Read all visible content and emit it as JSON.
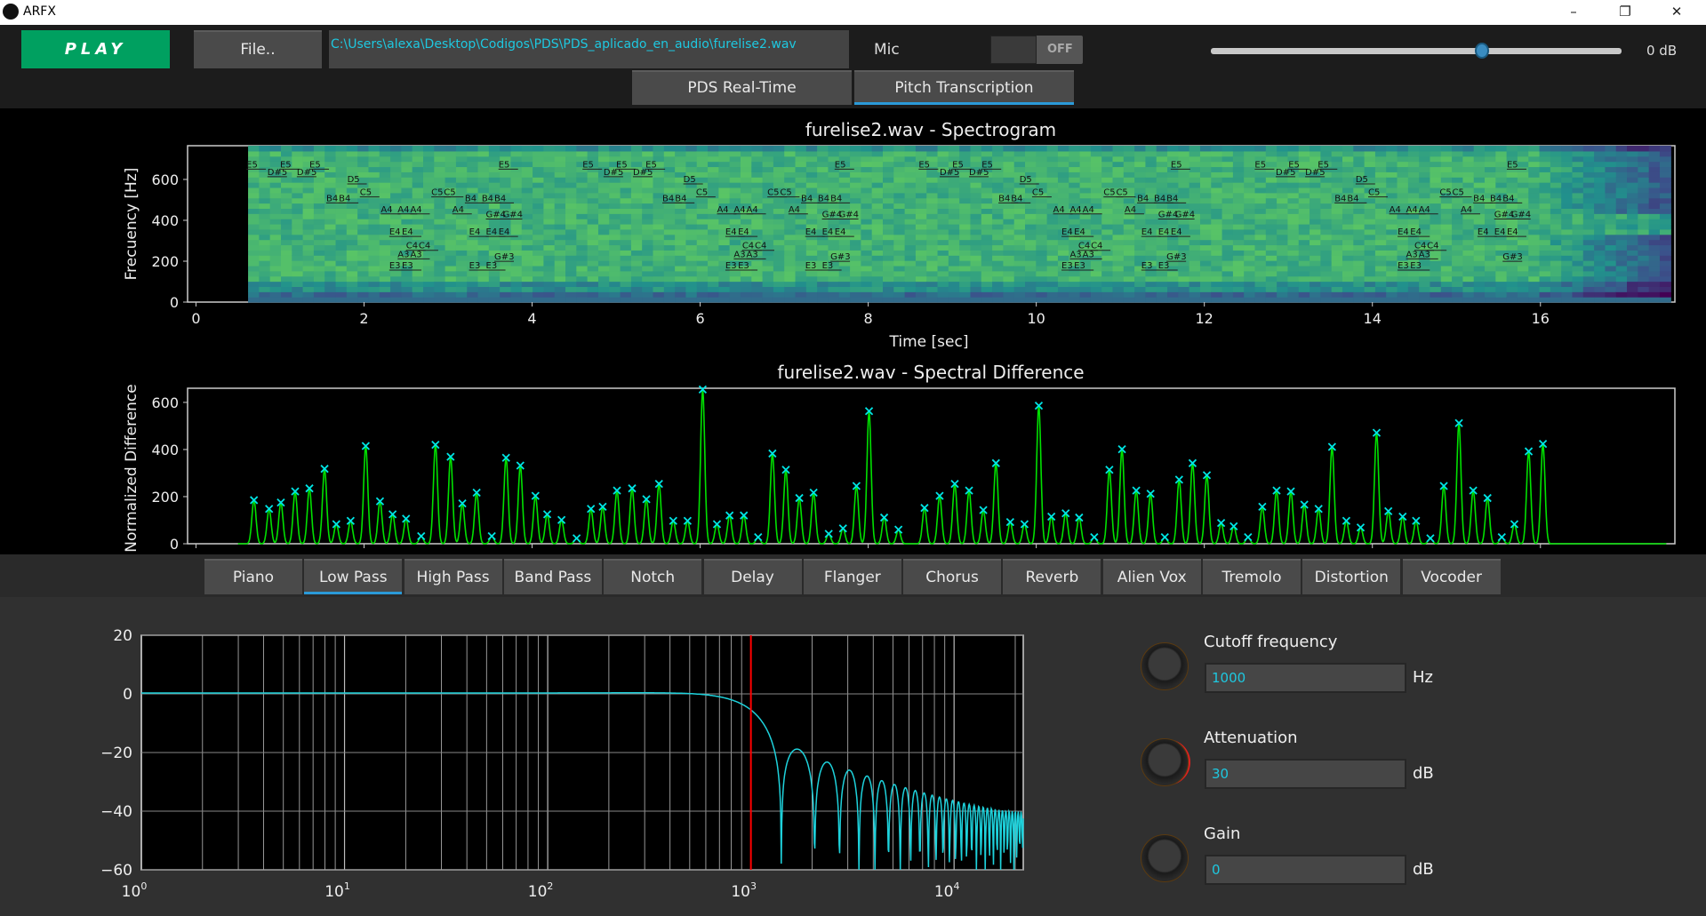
{
  "window": {
    "title": "ARFX",
    "min": "–",
    "max": "❐",
    "close": "✕"
  },
  "toolbar": {
    "play": "PLAY",
    "file": "File..",
    "path": "C:\\Users\\alexa\\Desktop\\Codigos\\PDS\\PDS_aplicado_en_audio\\furelise2.wav",
    "mic": "Mic",
    "mic_state": "OFF",
    "volume_label": "0 dB",
    "volume_fraction": 0.66
  },
  "tabs": [
    {
      "label": "PDS Real-Time"
    },
    {
      "label": "Pitch Transcription",
      "selected": true
    }
  ],
  "effects": [
    "Piano",
    "Low Pass",
    "High Pass",
    "Band Pass",
    "Notch",
    "Delay",
    "Flanger",
    "Chorus",
    "Reverb",
    "Alien Vox",
    "Tremolo",
    "Distortion",
    "Vocoder"
  ],
  "selected_effect": "Low Pass",
  "params": [
    {
      "label": "Cutoff frequency",
      "value": "1000",
      "unit": "Hz"
    },
    {
      "label": "Attenuation",
      "value": "30",
      "unit": "dB"
    },
    {
      "label": "Gain",
      "value": "0",
      "unit": "dB"
    }
  ],
  "colors": {
    "accent": "#2b9ad8",
    "play": "#00a060",
    "value_text": "#1ec8e0",
    "peaks": "#00e000",
    "markers": "#00e5e5",
    "response": "#1ed2dc",
    "cutoff_line": "#ff0000"
  },
  "chart_data": [
    {
      "type": "heatmap",
      "title": "furelise2.wav - Spectrogram",
      "xlabel": "Time [sec]",
      "ylabel": "Frecuency [Hz]",
      "xlim": [
        -0.1,
        17.6
      ],
      "ylim": [
        0,
        765
      ],
      "xticks": [
        "0",
        "2",
        "4",
        "6",
        "8",
        "10",
        "12",
        "14",
        "16"
      ],
      "yticks": [
        "0",
        "200",
        "400",
        "600"
      ],
      "colormap": "viridis",
      "data_start": 0.62,
      "data_end": 17.55,
      "notes": [
        [
          0.6,
          "E5"
        ],
        [
          0.85,
          "D#5"
        ],
        [
          1.0,
          "E5"
        ],
        [
          1.2,
          "D#5"
        ],
        [
          1.35,
          "E5"
        ],
        [
          1.55,
          "B4"
        ],
        [
          1.7,
          "B4"
        ],
        [
          1.8,
          "D5"
        ],
        [
          1.95,
          "C5"
        ],
        [
          2.2,
          "A4"
        ],
        [
          2.4,
          "A4"
        ],
        [
          2.55,
          "A4"
        ],
        [
          2.3,
          "E4"
        ],
        [
          2.45,
          "E4"
        ],
        [
          2.5,
          "C4"
        ],
        [
          2.65,
          "C4"
        ],
        [
          2.4,
          "A3"
        ],
        [
          2.55,
          "A3"
        ],
        [
          2.3,
          "E3"
        ],
        [
          2.45,
          "E3"
        ],
        [
          2.8,
          "C5"
        ],
        [
          2.95,
          "C5"
        ],
        [
          3.05,
          "A4"
        ],
        [
          3.2,
          "B4"
        ],
        [
          3.4,
          "B4"
        ],
        [
          3.55,
          "B4"
        ],
        [
          3.25,
          "E4"
        ],
        [
          3.45,
          "E4"
        ],
        [
          3.6,
          "E4"
        ],
        [
          3.45,
          "G#4"
        ],
        [
          3.65,
          "G#4"
        ],
        [
          3.55,
          "G#3"
        ],
        [
          3.25,
          "E3"
        ],
        [
          3.45,
          "E3"
        ],
        [
          3.6,
          "E5"
        ],
        [
          4.6,
          "E5"
        ],
        [
          4.85,
          "D#5"
        ],
        [
          5.0,
          "E5"
        ],
        [
          5.2,
          "D#5"
        ],
        [
          5.35,
          "E5"
        ],
        [
          5.55,
          "B4"
        ],
        [
          5.7,
          "B4"
        ],
        [
          5.8,
          "D5"
        ],
        [
          5.95,
          "C5"
        ],
        [
          6.2,
          "A4"
        ],
        [
          6.4,
          "A4"
        ],
        [
          6.55,
          "A4"
        ],
        [
          6.3,
          "E4"
        ],
        [
          6.45,
          "E4"
        ],
        [
          6.5,
          "C4"
        ],
        [
          6.65,
          "C4"
        ],
        [
          6.4,
          "A3"
        ],
        [
          6.55,
          "A3"
        ],
        [
          6.3,
          "E3"
        ],
        [
          6.45,
          "E3"
        ],
        [
          6.8,
          "C5"
        ],
        [
          6.95,
          "C5"
        ],
        [
          7.05,
          "A4"
        ],
        [
          7.2,
          "B4"
        ],
        [
          7.4,
          "B4"
        ],
        [
          7.55,
          "B4"
        ],
        [
          7.25,
          "E4"
        ],
        [
          7.45,
          "E4"
        ],
        [
          7.6,
          "E4"
        ],
        [
          7.45,
          "G#4"
        ],
        [
          7.65,
          "G#4"
        ],
        [
          7.55,
          "G#3"
        ],
        [
          7.25,
          "E3"
        ],
        [
          7.45,
          "E3"
        ],
        [
          7.6,
          "E5"
        ],
        [
          8.6,
          "E5"
        ],
        [
          8.85,
          "D#5"
        ],
        [
          9.0,
          "E5"
        ],
        [
          9.2,
          "D#5"
        ],
        [
          9.35,
          "E5"
        ],
        [
          9.55,
          "B4"
        ],
        [
          9.7,
          "B4"
        ],
        [
          9.8,
          "D5"
        ],
        [
          9.95,
          "C5"
        ],
        [
          10.2,
          "A4"
        ],
        [
          10.4,
          "A4"
        ],
        [
          10.55,
          "A4"
        ],
        [
          10.3,
          "E4"
        ],
        [
          10.45,
          "E4"
        ],
        [
          10.5,
          "C4"
        ],
        [
          10.65,
          "C4"
        ],
        [
          10.4,
          "A3"
        ],
        [
          10.55,
          "A3"
        ],
        [
          10.3,
          "E3"
        ],
        [
          10.45,
          "E3"
        ],
        [
          10.8,
          "C5"
        ],
        [
          10.95,
          "C5"
        ],
        [
          11.05,
          "A4"
        ],
        [
          11.2,
          "B4"
        ],
        [
          11.4,
          "B4"
        ],
        [
          11.55,
          "B4"
        ],
        [
          11.25,
          "E4"
        ],
        [
          11.45,
          "E4"
        ],
        [
          11.6,
          "E4"
        ],
        [
          11.45,
          "G#4"
        ],
        [
          11.65,
          "G#4"
        ],
        [
          11.55,
          "G#3"
        ],
        [
          11.25,
          "E3"
        ],
        [
          11.45,
          "E3"
        ],
        [
          11.6,
          "E5"
        ],
        [
          12.6,
          "E5"
        ],
        [
          12.85,
          "D#5"
        ],
        [
          13.0,
          "E5"
        ],
        [
          13.2,
          "D#5"
        ],
        [
          13.35,
          "E5"
        ],
        [
          13.55,
          "B4"
        ],
        [
          13.7,
          "B4"
        ],
        [
          13.8,
          "D5"
        ],
        [
          13.95,
          "C5"
        ],
        [
          14.2,
          "A4"
        ],
        [
          14.4,
          "A4"
        ],
        [
          14.55,
          "A4"
        ],
        [
          14.3,
          "E4"
        ],
        [
          14.45,
          "E4"
        ],
        [
          14.5,
          "C4"
        ],
        [
          14.65,
          "C4"
        ],
        [
          14.4,
          "A3"
        ],
        [
          14.55,
          "A3"
        ],
        [
          14.3,
          "E3"
        ],
        [
          14.45,
          "E3"
        ],
        [
          14.8,
          "C5"
        ],
        [
          14.95,
          "C5"
        ],
        [
          15.05,
          "A4"
        ],
        [
          15.2,
          "B4"
        ],
        [
          15.4,
          "B4"
        ],
        [
          15.55,
          "B4"
        ],
        [
          15.25,
          "E4"
        ],
        [
          15.45,
          "E4"
        ],
        [
          15.6,
          "E4"
        ],
        [
          15.45,
          "G#4"
        ],
        [
          15.65,
          "G#4"
        ],
        [
          15.55,
          "G#3"
        ],
        [
          15.6,
          "E5"
        ]
      ]
    },
    {
      "type": "line",
      "title": "furelise2.wav - Spectral Difference",
      "ylabel": "Normalized Difference",
      "xlim": [
        -0.1,
        17.6
      ],
      "ylim": [
        0,
        660
      ],
      "yticks": [
        "0",
        "200",
        "400",
        "600"
      ],
      "peaks": [
        [
          0.69,
          185
        ],
        [
          0.87,
          148
        ],
        [
          1.01,
          175
        ],
        [
          1.18,
          222
        ],
        [
          1.35,
          235
        ],
        [
          1.53,
          318
        ],
        [
          1.67,
          83
        ],
        [
          1.84,
          97
        ],
        [
          2.02,
          415
        ],
        [
          2.19,
          180
        ],
        [
          2.34,
          125
        ],
        [
          2.5,
          106
        ],
        [
          2.68,
          32
        ],
        [
          2.85,
          420
        ],
        [
          3.03,
          369
        ],
        [
          3.17,
          171
        ],
        [
          3.34,
          217
        ],
        [
          3.52,
          32
        ],
        [
          3.69,
          365
        ],
        [
          3.86,
          332
        ],
        [
          4.04,
          203
        ],
        [
          4.18,
          125
        ],
        [
          4.35,
          101
        ],
        [
          4.53,
          23
        ],
        [
          4.7,
          148
        ],
        [
          4.84,
          157
        ],
        [
          5.01,
          226
        ],
        [
          5.19,
          235
        ],
        [
          5.36,
          189
        ],
        [
          5.51,
          254
        ],
        [
          5.68,
          97
        ],
        [
          5.85,
          97
        ],
        [
          6.03,
          655
        ],
        [
          6.2,
          83
        ],
        [
          6.35,
          120
        ],
        [
          6.52,
          120
        ],
        [
          6.69,
          28
        ],
        [
          6.86,
          383
        ],
        [
          7.02,
          314
        ],
        [
          7.18,
          194
        ],
        [
          7.35,
          217
        ],
        [
          7.53,
          42
        ],
        [
          7.7,
          65
        ],
        [
          7.86,
          245
        ],
        [
          8.01,
          563
        ],
        [
          8.19,
          111
        ],
        [
          8.36,
          60
        ],
        [
          8.67,
          152
        ],
        [
          8.85,
          203
        ],
        [
          9.03,
          254
        ],
        [
          9.2,
          226
        ],
        [
          9.37,
          143
        ],
        [
          9.52,
          342
        ],
        [
          9.69,
          92
        ],
        [
          9.86,
          83
        ],
        [
          10.03,
          586
        ],
        [
          10.18,
          115
        ],
        [
          10.35,
          129
        ],
        [
          10.51,
          111
        ],
        [
          10.69,
          28
        ],
        [
          10.87,
          314
        ],
        [
          11.02,
          401
        ],
        [
          11.19,
          226
        ],
        [
          11.36,
          212
        ],
        [
          11.53,
          28
        ],
        [
          11.7,
          272
        ],
        [
          11.86,
          342
        ],
        [
          12.03,
          291
        ],
        [
          12.2,
          88
        ],
        [
          12.35,
          74
        ],
        [
          12.52,
          28
        ],
        [
          12.69,
          157
        ],
        [
          12.86,
          226
        ],
        [
          13.03,
          222
        ],
        [
          13.19,
          166
        ],
        [
          13.36,
          148
        ],
        [
          13.52,
          411
        ],
        [
          13.69,
          97
        ],
        [
          13.86,
          69
        ],
        [
          14.05,
          471
        ],
        [
          14.19,
          138
        ],
        [
          14.36,
          115
        ],
        [
          14.52,
          97
        ],
        [
          14.69,
          23
        ],
        [
          14.85,
          245
        ],
        [
          15.03,
          512
        ],
        [
          15.2,
          226
        ],
        [
          15.37,
          194
        ],
        [
          15.54,
          28
        ],
        [
          15.69,
          83
        ],
        [
          15.86,
          392
        ],
        [
          16.03,
          424
        ]
      ]
    },
    {
      "type": "line",
      "title": "",
      "xscale": "log",
      "xlim": [
        1,
        21900
      ],
      "ylim": [
        -60,
        20
      ],
      "xticks": [
        "10",
        "10",
        "10",
        "10",
        "10"
      ],
      "xtick_exp": [
        "0",
        "1",
        "2",
        "3",
        "4"
      ],
      "yticks": [
        "20",
        "0",
        "−20",
        "−40",
        "−60"
      ],
      "grid": true,
      "cutoff_hz": 1000,
      "sample_rate": 44100,
      "taps": 65
    }
  ]
}
